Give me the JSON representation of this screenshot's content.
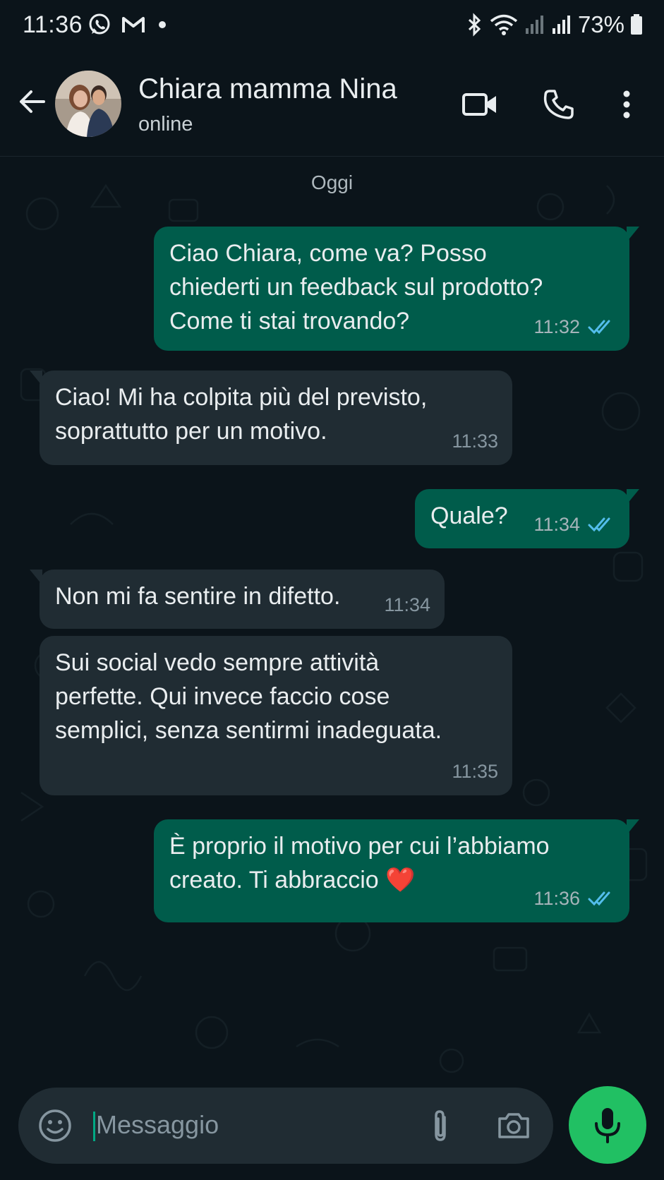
{
  "status_bar": {
    "time": "11:36",
    "battery": "73%",
    "left_icons": [
      "whatsapp-icon",
      "gmail-icon",
      "dot-icon"
    ],
    "right_icons": [
      "bluetooth-icon",
      "wifi-icon",
      "signal-icon",
      "signal-icon",
      "battery-icon"
    ]
  },
  "header": {
    "contact_name": "Chiara mamma Nina",
    "status": "online",
    "icons": [
      "back-arrow-icon",
      "video-call-icon",
      "phone-icon",
      "more-vert-icon"
    ]
  },
  "chat": {
    "date_label": "Oggi",
    "messages": [
      {
        "direction": "out",
        "lines": [
          "Ciao Chiara, come va? Posso",
          "chiederti un feedback sul prodotto?",
          "Come ti stai trovando?"
        ],
        "time": "11:32",
        "read": true
      },
      {
        "direction": "in",
        "lines": [
          "Ciao! Mi ha colpita più del previsto,",
          "soprattutto per un motivo."
        ],
        "time": "11:33"
      },
      {
        "direction": "out",
        "lines": [
          "Quale?"
        ],
        "time": "11:34",
        "read": true
      },
      {
        "direction": "in",
        "lines": [
          "Non mi fa sentire in difetto."
        ],
        "time": "11:34"
      },
      {
        "direction": "in",
        "lines": [
          "Sui social vedo sempre attività",
          "perfette. Qui invece faccio cose",
          "semplici, senza sentirmi inadeguata."
        ],
        "time": "11:35"
      },
      {
        "direction": "out",
        "lines": [
          "È proprio il motivo per cui l’abbiamo",
          "creato. Ti abbraccio ❤️"
        ],
        "time": "11:36",
        "read": true
      }
    ]
  },
  "input_bar": {
    "placeholder": "Messaggio",
    "icons": [
      "emoji-icon",
      "attach-icon",
      "camera-icon",
      "mic-icon"
    ]
  },
  "colors": {
    "background": "#0b141a",
    "outgoing_bubble": "#005c4b",
    "incoming_bubble": "#202c33",
    "read_ticks": "#53bdeb",
    "mic_button": "#21c063"
  }
}
